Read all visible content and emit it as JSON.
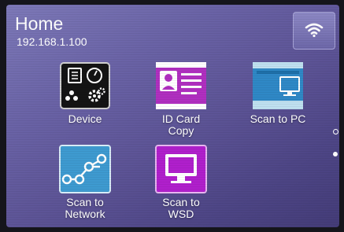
{
  "header": {
    "title": "Home",
    "ip_address": "192.168.1.100"
  },
  "wifi_button": {
    "icon": "wifi-icon"
  },
  "tiles": [
    {
      "label": "Device",
      "icon": "device-icon"
    },
    {
      "label": "ID Card\nCopy",
      "icon": "id-card-icon"
    },
    {
      "label": "Scan to PC",
      "icon": "monitor-icon"
    },
    {
      "label": "Scan to\nNetwork",
      "icon": "network-icon"
    },
    {
      "label": "Scan to\nWSD",
      "icon": "monitor-icon"
    }
  ],
  "pagination": {
    "pages": 2,
    "current": 2
  },
  "colors": {
    "device_tile": "#111111",
    "id_card_tile": "#b02fc0",
    "scan_pc_tile": "#2f88c6",
    "scan_network_tile": "#3e9ad0",
    "scan_wsd_tile": "#b01fcc"
  }
}
